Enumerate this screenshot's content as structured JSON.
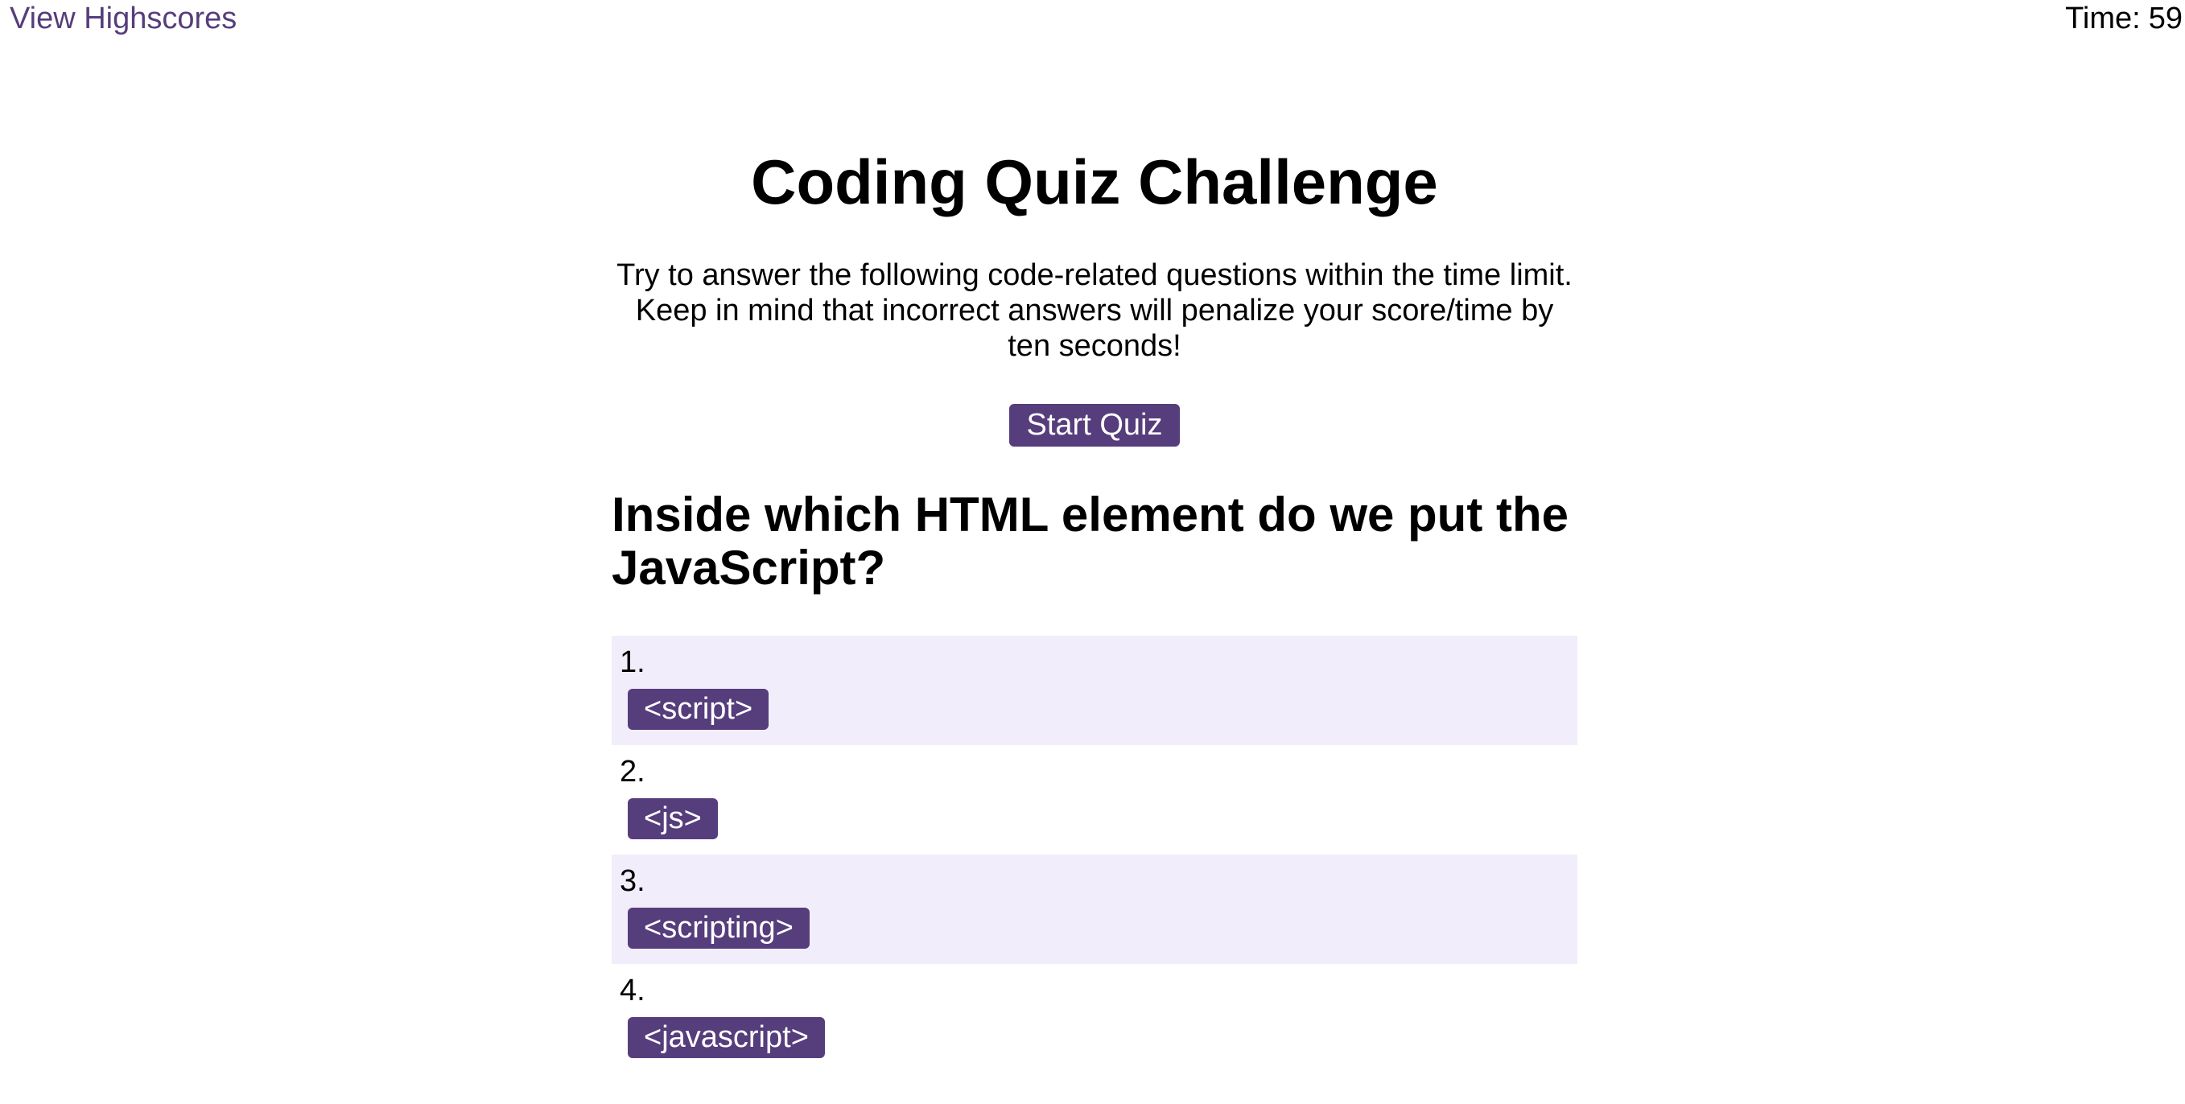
{
  "header": {
    "highscores_link": "View Highscores",
    "timer_label": "Time:",
    "timer_value": "59"
  },
  "start_screen": {
    "title": "Coding Quiz Challenge",
    "intro": "Try to answer the following code-related questions within the time limit. Keep in mind that incorrect answers will penalize your score/time by ten seconds!",
    "start_button": "Start Quiz"
  },
  "quiz": {
    "question": "Inside which HTML element do we put the JavaScript?",
    "choices": [
      {
        "number": "1.",
        "label": "<script>"
      },
      {
        "number": "2.",
        "label": "<js>"
      },
      {
        "number": "3.",
        "label": "<scripting>"
      },
      {
        "number": "4.",
        "label": "<javascript>"
      }
    ]
  },
  "colors": {
    "accent": "#563d7c",
    "shaded_row": "#f2edfa",
    "background": "#ffffff",
    "text": "#000000"
  }
}
